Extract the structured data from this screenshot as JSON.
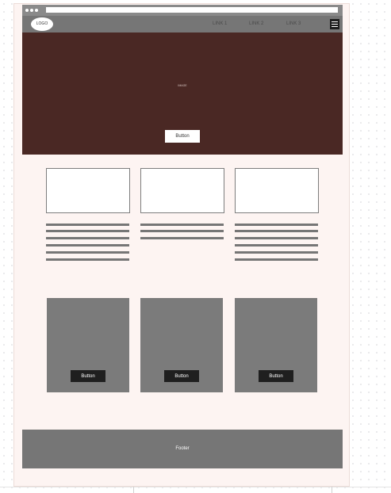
{
  "header": {
    "logo": "LOGO",
    "links": [
      "LINK 1",
      "LINK 2",
      "LINK 3"
    ]
  },
  "hero": {
    "image_label": "IMAGE",
    "button_label": "Button"
  },
  "products": {
    "button_label": "Button"
  },
  "footer": {
    "label": "Footer"
  },
  "colors": {
    "hero_bg": "#4a2824",
    "nav_bg": "#767676",
    "page_bg": "#fdf4f2",
    "card_bg": "#7b7b7b",
    "card_button_bg": "#1f1f1f"
  }
}
